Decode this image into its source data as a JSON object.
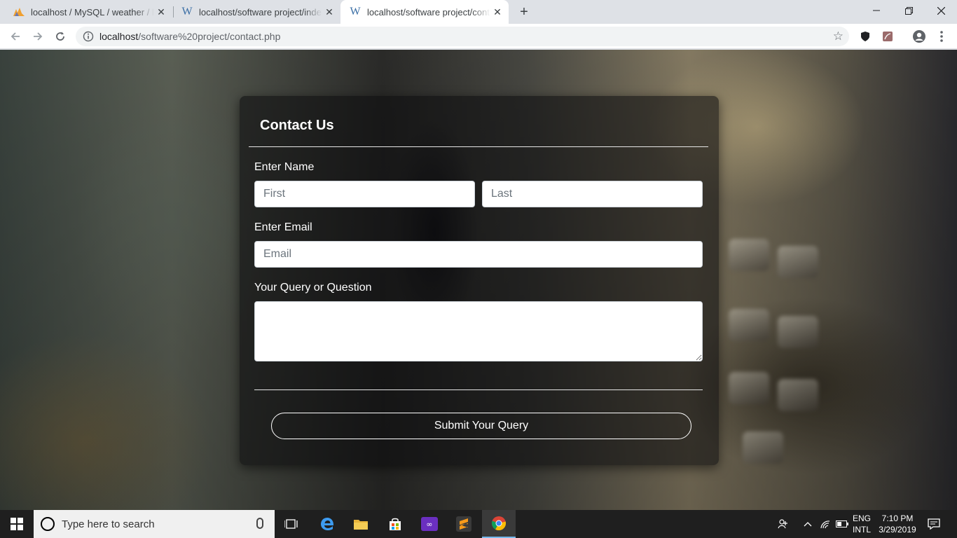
{
  "browser": {
    "tabs": [
      {
        "title": "localhost / MySQL / weather / local",
        "favicon": "phpmyadmin-icon",
        "active": false
      },
      {
        "title": "localhost/software project/index.php",
        "favicon": "w-icon",
        "active": false
      },
      {
        "title": "localhost/software project/contact.php",
        "favicon": "w-icon",
        "active": true
      }
    ],
    "address": {
      "host": "localhost",
      "path": "/software%20project/contact.php"
    }
  },
  "form": {
    "title": "Contact Us",
    "name_label": "Enter Name",
    "first_placeholder": "First",
    "last_placeholder": "Last",
    "email_label": "Enter Email",
    "email_placeholder": "Email",
    "query_label": "Your Query or Question",
    "query_value": "",
    "submit_label": "Submit Your Query"
  },
  "taskbar": {
    "search_placeholder": "Type here to search",
    "lang_top": "ENG",
    "lang_bottom": "INTL",
    "time": "7:10 PM",
    "date": "3/29/2019"
  },
  "colors": {
    "accent_tab": "#ffffff",
    "card_bg": "rgba(12,12,14,0.58)",
    "taskbar_bg": "#1f1f1f"
  }
}
